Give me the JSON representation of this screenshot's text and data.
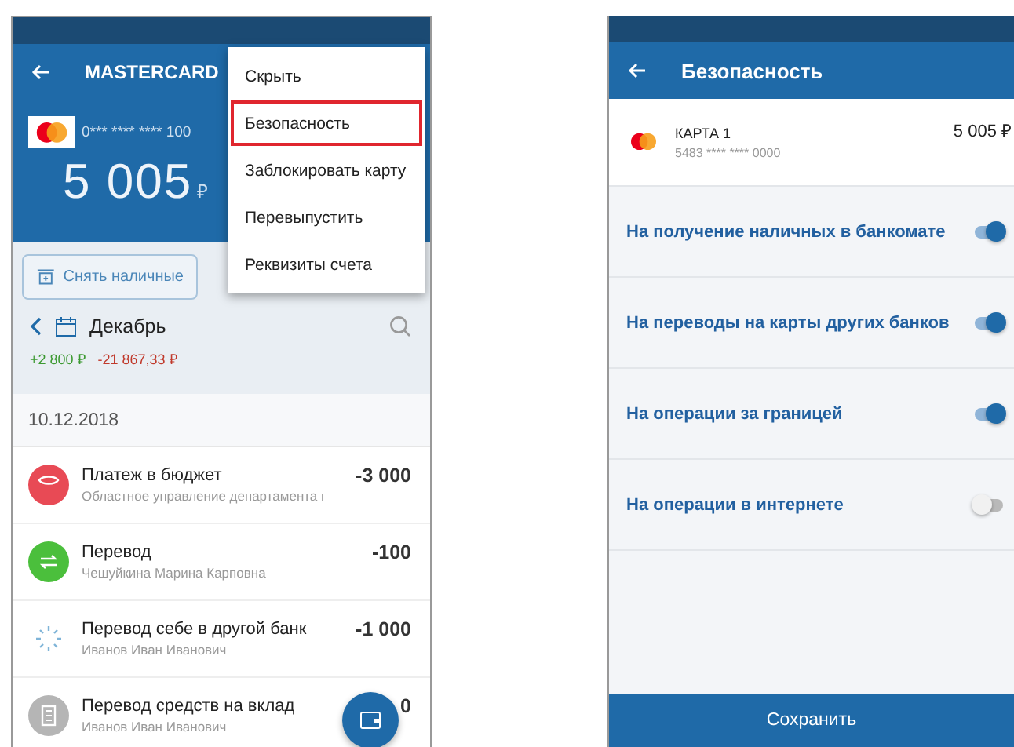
{
  "card_screen": {
    "title": "MASTERCARD",
    "card_number": "0*** **** **** 100",
    "balance": "5 005",
    "currency": "₽",
    "withdraw_button": "Снять наличные",
    "month": "Декабрь",
    "income": "+2 800 ₽",
    "expense": "-21 867,33 ₽",
    "date": "10.12.2018",
    "transactions": [
      {
        "kind": "budget",
        "title": "Платеж в бюджет",
        "subtitle": "Областное управление департамента г",
        "amount": "-3 000"
      },
      {
        "kind": "transfer",
        "title": "Перевод",
        "subtitle": "Чешуйкина Марина Карповна",
        "amount": "-100"
      },
      {
        "kind": "pending",
        "title": "Перевод себе в другой банк",
        "subtitle": "Иванов Иван Иванович",
        "amount": "-1 000"
      },
      {
        "kind": "deposit",
        "title": "Перевод средств на вклад",
        "subtitle": "Иванов Иван Иванович",
        "amount": "0"
      }
    ]
  },
  "menu": {
    "items": [
      {
        "label": "Скрыть",
        "highlighted": false
      },
      {
        "label": "Безопасность",
        "highlighted": true
      },
      {
        "label": "Заблокировать карту",
        "highlighted": false
      },
      {
        "label": "Перевыпустить",
        "highlighted": false
      },
      {
        "label": "Реквизиты счета",
        "highlighted": false
      }
    ]
  },
  "security_screen": {
    "title": "Безопасность",
    "card": {
      "name": "КАРТА 1",
      "number": "5483 **** **** 0000",
      "balance": "5 005 ₽"
    },
    "settings": [
      {
        "label": "На получение наличных в банкомате",
        "on": true
      },
      {
        "label": "На переводы на карты других банков",
        "on": true
      },
      {
        "label": "На операции за границей",
        "on": true
      },
      {
        "label": "На операции в интернете",
        "on": false
      }
    ],
    "save_button": "Сохранить"
  }
}
